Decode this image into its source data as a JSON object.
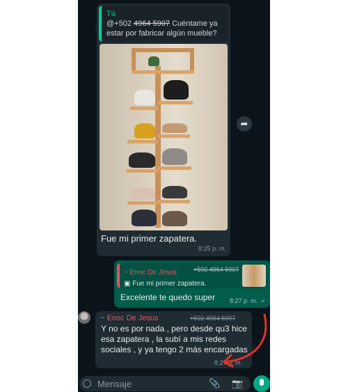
{
  "quoted_message": {
    "author": "Tú",
    "mention": "@+502",
    "mention_number_struck": "4964 5907",
    "text": "Cuéntame ya estar por fabricar algún mueble?"
  },
  "incoming_photo_message": {
    "caption": "Fue mi primer zapatera.",
    "time": "8:25 p. m."
  },
  "outgoing_reply": {
    "quoted_author": "~ Enoc De Jesus",
    "quoted_number": "+502 4964 5907",
    "quoted_text": "Fue mi primer zapatera.",
    "text": "Excelente te quedo super",
    "time": "8:27 p. m.",
    "status_glyph": "✓"
  },
  "incoming_text_message": {
    "author": "Enoc De Jesus",
    "number": "+502 4964 5907",
    "text": "Y no es por nada , pero desde qu3 hice esa zapatera ,  la subí a mis redes sociales , y ya tengo 2 más encargadas",
    "time": "8:27 p. m."
  },
  "composer": {
    "placeholder": "Mensaje",
    "icons": [
      "emoji-icon",
      "attach-icon",
      "camera-icon",
      "microphone-icon"
    ]
  },
  "colors": {
    "chat_background": "#0b141a",
    "incoming_bubble": "#202c33",
    "outgoing_bubble": "#005c4b",
    "accent_green": "#00a884",
    "quote_author_pink": "#ea4e6b",
    "annotation_arrow": "#e0332c"
  }
}
